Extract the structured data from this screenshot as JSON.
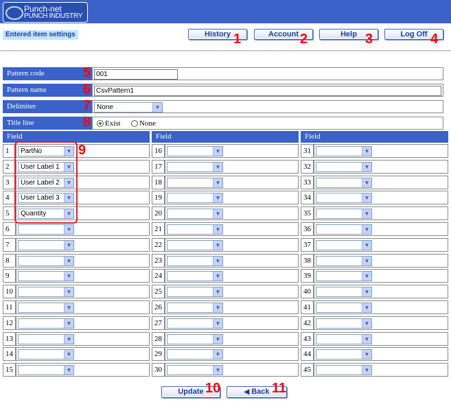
{
  "header": {
    "logo_line1": "Punch-net",
    "logo_line2": "PUNCH INDUSTRY",
    "subtitle": "Entered item settings"
  },
  "nav": {
    "history": "History",
    "account": "Account",
    "help": "Help",
    "logoff": "Log Off"
  },
  "badges": [
    "1",
    "2",
    "3",
    "4",
    "5",
    "6",
    "7",
    "8",
    "9",
    "10",
    "11"
  ],
  "form": {
    "pattern_code_label": "Pattern code",
    "pattern_code_value": "001",
    "pattern_name_label": "Pattern name",
    "pattern_name_value": "CsvPattern1",
    "delimiter_label": "Delimiter",
    "delimiter_value": "None",
    "title_line_label": "Title line",
    "title_exist": "Exist",
    "title_none": "None",
    "title_selected": "Exist"
  },
  "fields": {
    "column_header": "Field",
    "rows": [
      {
        "n": "1",
        "v": ""
      },
      {
        "n": "2",
        "v": ""
      },
      {
        "n": "3",
        "v": ""
      },
      {
        "n": "4",
        "v": ""
      },
      {
        "n": "5",
        "v": ""
      },
      {
        "n": "6",
        "v": ""
      },
      {
        "n": "7",
        "v": ""
      },
      {
        "n": "8",
        "v": ""
      },
      {
        "n": "9",
        "v": ""
      },
      {
        "n": "10",
        "v": ""
      },
      {
        "n": "11",
        "v": ""
      },
      {
        "n": "12",
        "v": ""
      },
      {
        "n": "13",
        "v": ""
      },
      {
        "n": "14",
        "v": ""
      },
      {
        "n": "15",
        "v": ""
      },
      {
        "n": "16",
        "v": ""
      },
      {
        "n": "17",
        "v": ""
      },
      {
        "n": "18",
        "v": ""
      },
      {
        "n": "19",
        "v": ""
      },
      {
        "n": "20",
        "v": ""
      },
      {
        "n": "21",
        "v": ""
      },
      {
        "n": "22",
        "v": ""
      },
      {
        "n": "23",
        "v": ""
      },
      {
        "n": "24",
        "v": ""
      },
      {
        "n": "25",
        "v": ""
      },
      {
        "n": "26",
        "v": ""
      },
      {
        "n": "27",
        "v": ""
      },
      {
        "n": "28",
        "v": ""
      },
      {
        "n": "29",
        "v": ""
      },
      {
        "n": "30",
        "v": ""
      },
      {
        "n": "31",
        "v": ""
      },
      {
        "n": "32",
        "v": ""
      },
      {
        "n": "33",
        "v": ""
      },
      {
        "n": "34",
        "v": ""
      },
      {
        "n": "35",
        "v": ""
      },
      {
        "n": "36",
        "v": ""
      },
      {
        "n": "37",
        "v": ""
      },
      {
        "n": "38",
        "v": ""
      },
      {
        "n": "39",
        "v": ""
      },
      {
        "n": "40",
        "v": ""
      },
      {
        "n": "41",
        "v": ""
      },
      {
        "n": "42",
        "v": ""
      },
      {
        "n": "43",
        "v": ""
      },
      {
        "n": "44",
        "v": ""
      },
      {
        "n": "45",
        "v": ""
      }
    ],
    "values_first5": [
      "PartNo",
      "User Label 1",
      "User Label 2",
      "User Label 3",
      "Quantity"
    ]
  },
  "actions": {
    "update": "Update",
    "back": "Back",
    "back_icon": "left-arrow-icon"
  },
  "colors": {
    "accent": "#3a62c9",
    "annotation_red": "#e0202a"
  }
}
